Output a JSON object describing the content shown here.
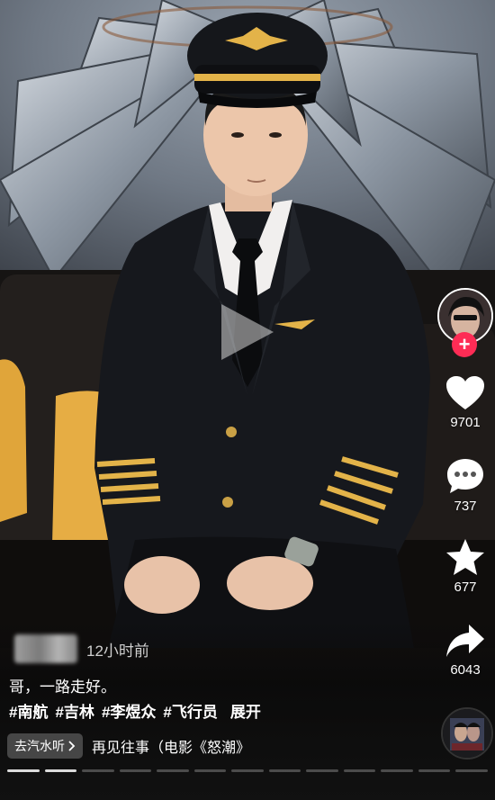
{
  "video": {
    "state": "paused"
  },
  "author": {
    "timestamp": "12小时前"
  },
  "actions": {
    "likes": "9701",
    "comments": "737",
    "favorites": "677",
    "shares": "6043"
  },
  "caption": {
    "text": "哥，一路走好。",
    "hashtags": [
      "#南航",
      "#吉林",
      "#李煜众",
      "#飞行员"
    ],
    "expand_label": "展开"
  },
  "music": {
    "listen_label": "去汽水听",
    "title": "再见往事（电影《怒潮》"
  },
  "progress": {
    "segments": 13,
    "active_segments": 2
  },
  "colors": {
    "accent": "#fe2c55",
    "gold": "#e3b349"
  },
  "icons": [
    "play-icon",
    "heart-icon",
    "comment-icon",
    "star-icon",
    "share-icon",
    "plus-icon",
    "chevron-right-icon",
    "music-disc-icon"
  ]
}
